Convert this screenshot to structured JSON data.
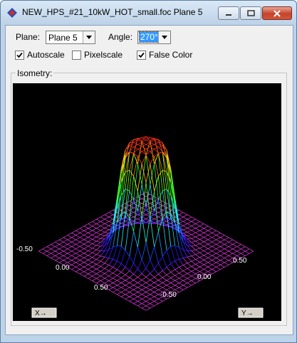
{
  "window": {
    "title": "NEW_HPS_#21_10kW_HOT_small.foc Plane 5",
    "accent": "#bcd3ea",
    "close_color": "#c6432b"
  },
  "controls": {
    "plane_label": "Plane:",
    "plane_value": "Plane 5",
    "angle_label": "Angle:",
    "angle_value": "270°",
    "autoscale_label": "Autoscale",
    "autoscale_checked": true,
    "pixelscale_label": "Pixelscale",
    "pixelscale_checked": false,
    "falsecolor_label": "False Color",
    "falsecolor_checked": true
  },
  "isometry": {
    "group_label": "Isometry:",
    "x_axis_ticks": [
      "-0.50",
      "0.00",
      "0.50"
    ],
    "y_axis_ticks": [
      "0.50",
      "0.00",
      "-0.50"
    ],
    "x_button": "X→",
    "y_button": "Y→",
    "plot_background": "#000000",
    "grid_base_color": "#cc33cc"
  }
}
